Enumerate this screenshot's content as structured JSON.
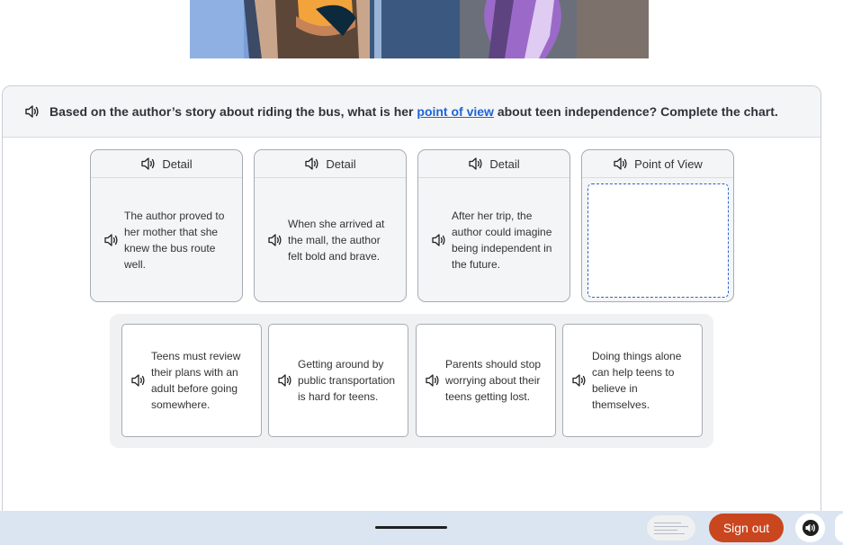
{
  "question": {
    "text_before": "Based on the author’s story about riding the bus, what is her ",
    "link": "point of view",
    "text_after": " about teen independence? Complete the chart."
  },
  "chart": {
    "columns": [
      {
        "heading": "Detail",
        "text": "The author proved to her mother that she knew the bus route well."
      },
      {
        "heading": "Detail",
        "text": "When she arrived at the mall, the author felt bold and brave."
      },
      {
        "heading": "Detail",
        "text": "After her trip, the author could imagine being independent in the future."
      },
      {
        "heading": "Point of View",
        "text": ""
      }
    ]
  },
  "answers": [
    {
      "text": "Teens must review their plans with an adult before going somewhere."
    },
    {
      "text": "Getting around by public transportation is hard for teens."
    },
    {
      "text": "Parents should stop worrying about their teens getting lost."
    },
    {
      "text": "Doing things alone can help teens to believe in themselves."
    }
  ],
  "bottom_bar": {
    "signout_label": "Sign out",
    "signout_color": "#c9461f"
  },
  "colors": {
    "link": "#1f64d6",
    "drop_zone_border": "#2e62c9",
    "bar": "#dbe5f1"
  },
  "icons": {
    "speaker": "speaker-icon",
    "audio": "audio-toggle-icon"
  }
}
